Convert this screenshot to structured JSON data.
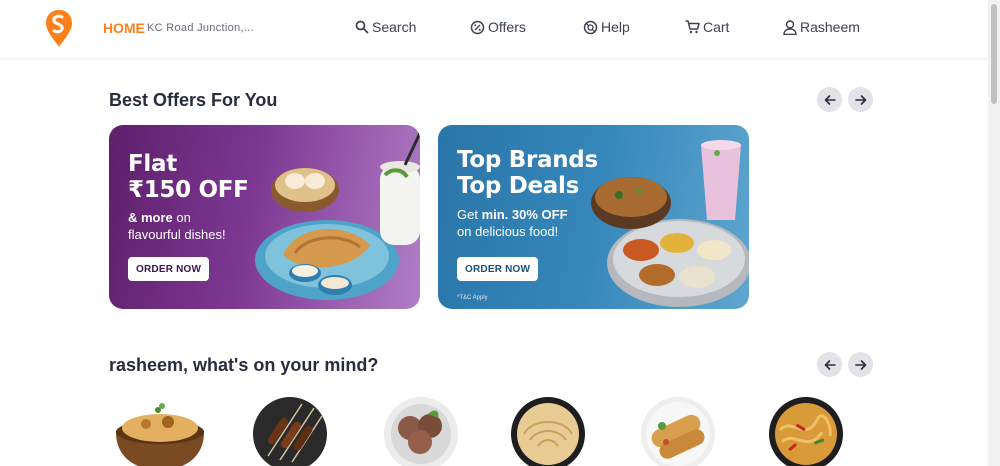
{
  "header": {
    "home_label": "HOME",
    "address": "KC Road Junction,...",
    "nav": [
      {
        "label": "Search",
        "icon": "search-icon"
      },
      {
        "label": "Offers",
        "icon": "offers-icon"
      },
      {
        "label": "Help",
        "icon": "help-icon"
      },
      {
        "label": "Cart",
        "icon": "cart-icon"
      },
      {
        "label": "Rasheem",
        "icon": "user-icon"
      }
    ],
    "accent_color": "#fc8019"
  },
  "offers": {
    "title": "Best Offers For You",
    "cards": [
      {
        "line1": "Flat",
        "line2": "₹150 OFF",
        "sub_bold": "& more",
        "sub_rest": " on",
        "sub_line2": "flavourful dishes!",
        "button": "ORDER NOW"
      },
      {
        "line1": "Top Brands",
        "line2": "Top Deals",
        "sub_pre": "Get ",
        "sub_bold": "min. 30% OFF",
        "sub_line2": "on delicious food!",
        "button": "ORDER NOW",
        "tc": "*T&C Apply"
      }
    ]
  },
  "mind": {
    "title": "rasheem, what's on your mind?",
    "items": [
      "biryani-icon",
      "kebab-icon",
      "ice-cream-icon",
      "paratha-icon",
      "roll-icon",
      "noodles-icon"
    ]
  }
}
